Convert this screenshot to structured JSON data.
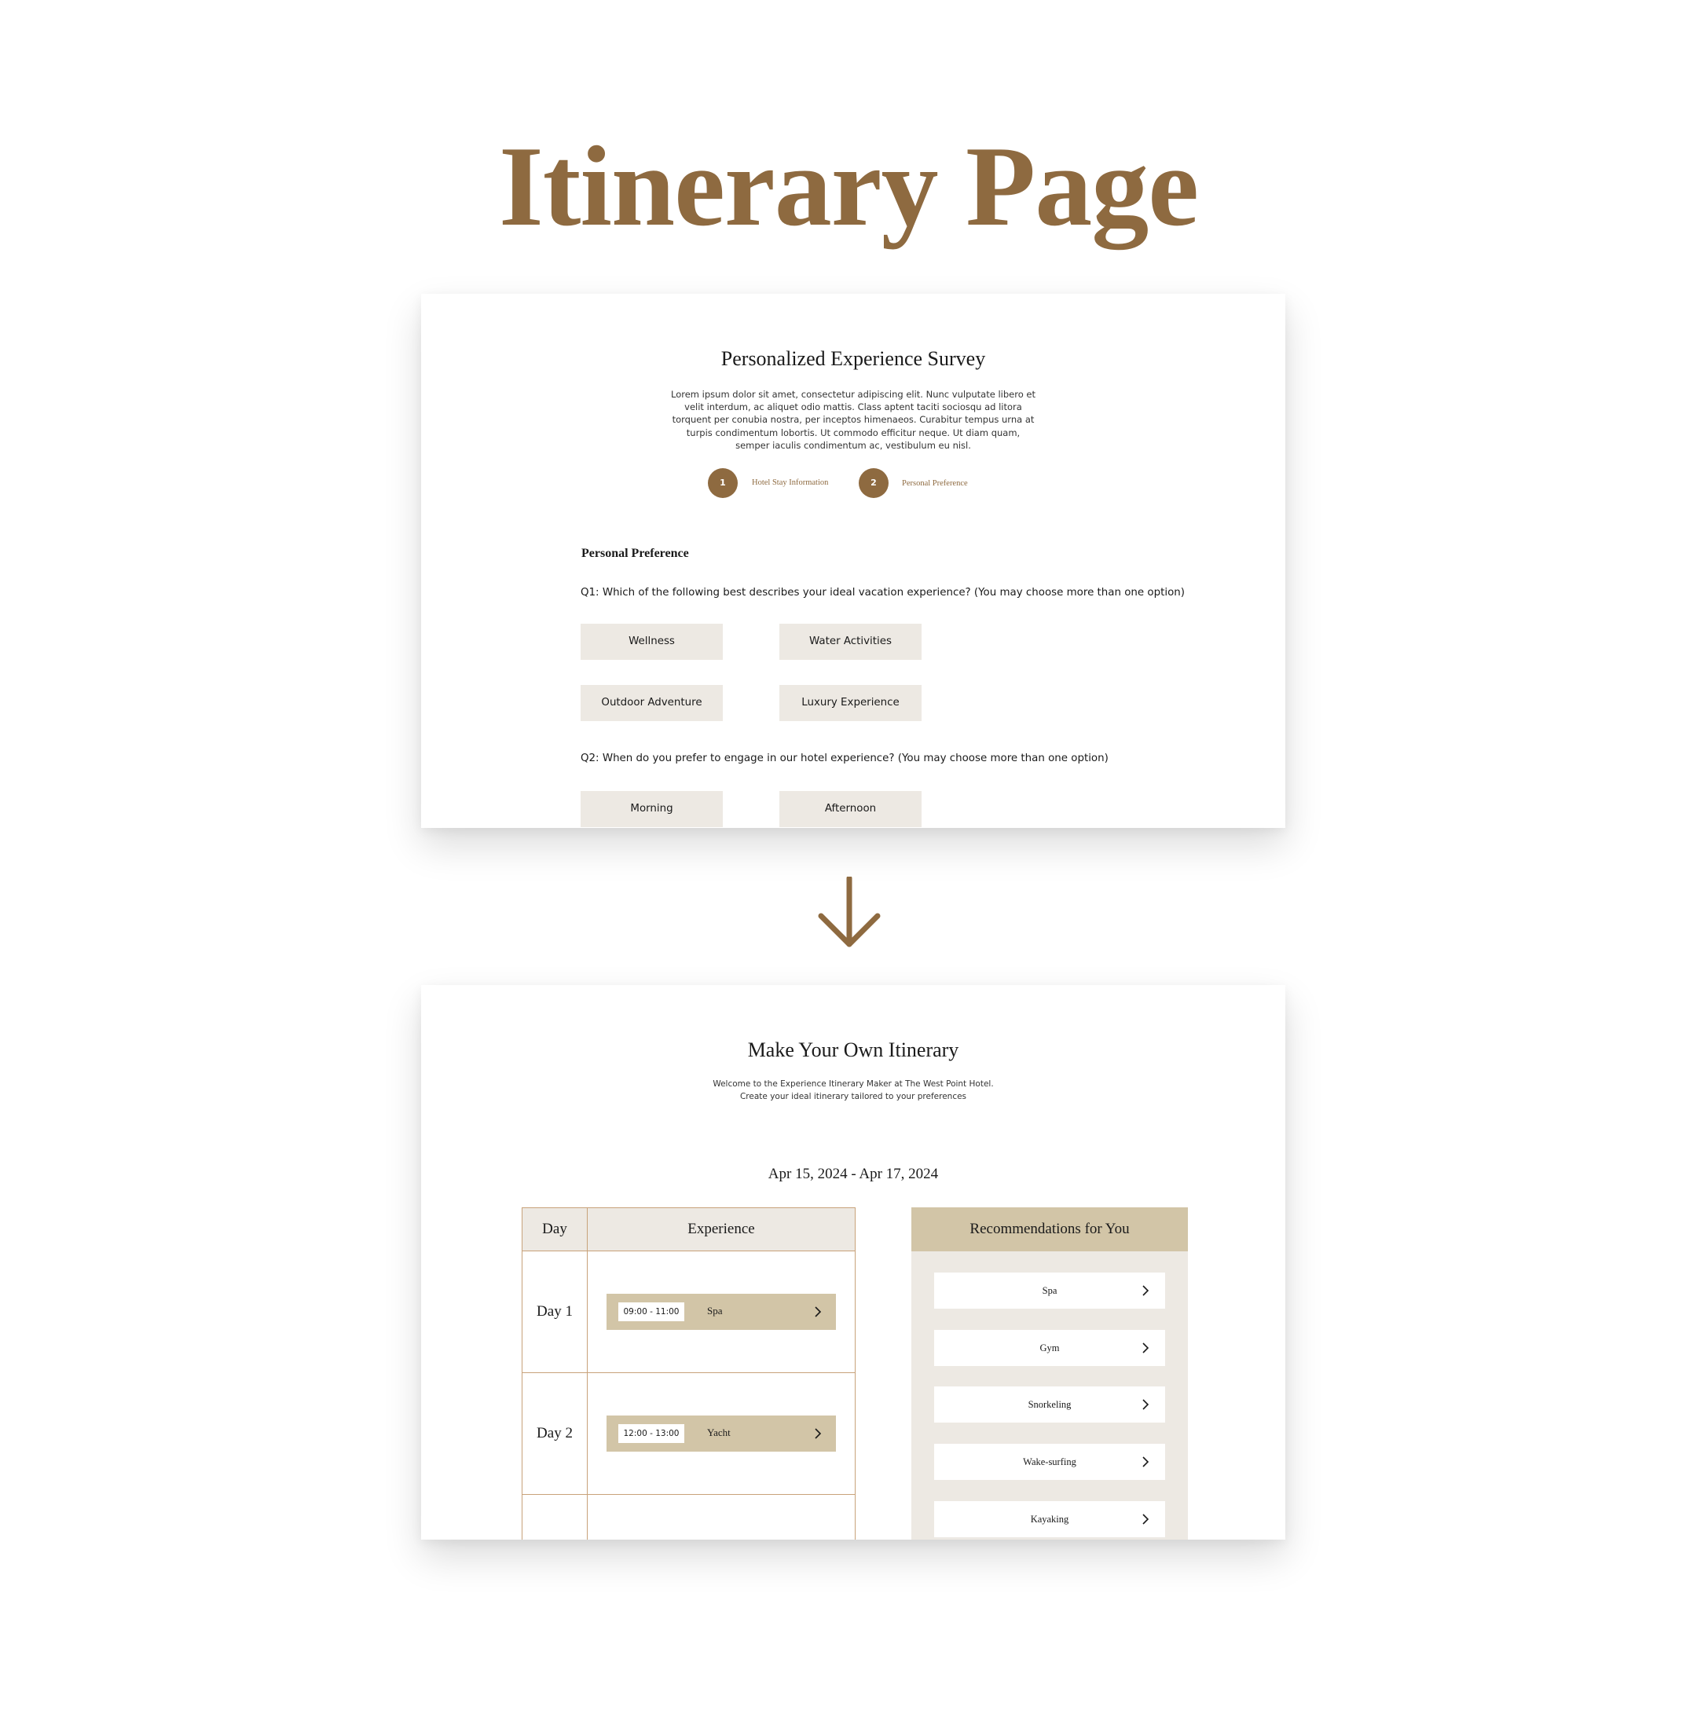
{
  "page_title": "Itinerary Page",
  "colors": {
    "brand": "#8e6a40",
    "option_bg": "#ede9e3",
    "accent_tan": "#d2c5a7",
    "table_border": "#c8a27a"
  },
  "survey": {
    "title": "Personalized Experience Survey",
    "intro": "Lorem ipsum dolor sit amet, consectetur adipiscing elit. Nunc vulputate libero et velit interdum, ac aliquet odio mattis. Class aptent taciti sociosqu ad litora torquent per conubia nostra, per inceptos himenaeos. Curabitur tempus urna at turpis condimentum lobortis. Ut commodo efficitur neque. Ut diam quam, semper iaculis condimentum ac, vestibulum eu nisl.",
    "steps": [
      {
        "number": "1",
        "label": "Hotel Stay Information"
      },
      {
        "number": "2",
        "label": "Personal Preference"
      }
    ],
    "section_title": "Personal Preference",
    "q1": {
      "text": "Q1: Which of the following best describes your ideal vacation experience? (You may choose more than one option)",
      "options": [
        "Wellness",
        "Water Activities",
        "Outdoor Adventure",
        "Luxury Experience"
      ]
    },
    "q2": {
      "text": "Q2: When do you prefer to engage in our hotel experience? (You may choose more than one option)",
      "options": [
        "Morning",
        "Afternoon"
      ]
    }
  },
  "arrow_icon": "arrow-down-icon",
  "itinerary": {
    "title": "Make Your Own Itinerary",
    "intro_line1": "Welcome to the Experience Itinerary Maker at The West Point Hotel.",
    "intro_line2": "Create your ideal itinerary tailored to your preferences",
    "date_range": "Apr 15, 2024 - Apr 17, 2024",
    "table": {
      "col_day": "Day",
      "col_experience": "Experience",
      "rows": [
        {
          "day": "Day 1",
          "time": "09:00 - 11:00",
          "experience": "Spa"
        },
        {
          "day": "Day 2",
          "time": "12:00 - 13:00",
          "experience": "Yacht"
        }
      ]
    },
    "recommendations": {
      "title": "Recommendations for You",
      "items": [
        "Spa",
        "Gym",
        "Snorkeling",
        "Wake-surfing",
        "Kayaking"
      ]
    }
  }
}
